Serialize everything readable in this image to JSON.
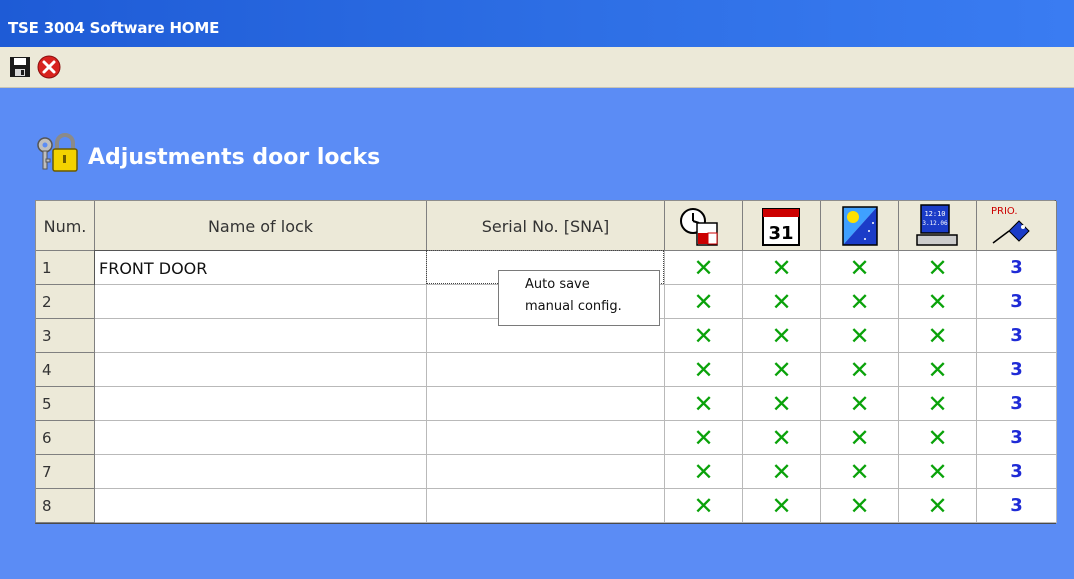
{
  "window": {
    "title": "TSE 3004 Software HOME"
  },
  "toolbar": {
    "save": {
      "icon": "floppy-disk-icon"
    },
    "close": {
      "icon": "red-x-close-icon"
    }
  },
  "page": {
    "title": "Adjustments door locks",
    "icon": "padlock-keys-icon"
  },
  "table": {
    "headers": {
      "num": "Num.",
      "name": "Name of lock",
      "serial": "Serial No. [SNA]",
      "icons": [
        "clock-onoff-icon",
        "calendar-icon",
        "sun-night-icon",
        "computer-clock-icon",
        "prio-key-icon"
      ],
      "prio_label": "PRIO."
    },
    "rows": [
      {
        "num": "1",
        "name": "FRONT DOOR",
        "serial": "",
        "flags": [
          "✕",
          "✕",
          "✕",
          "✕"
        ],
        "prio": "3"
      },
      {
        "num": "2",
        "name": "",
        "serial": "",
        "flags": [
          "✕",
          "✕",
          "✕",
          "✕"
        ],
        "prio": "3"
      },
      {
        "num": "3",
        "name": "",
        "serial": "",
        "flags": [
          "✕",
          "✕",
          "✕",
          "✕"
        ],
        "prio": "3"
      },
      {
        "num": "4",
        "name": "",
        "serial": "",
        "flags": [
          "✕",
          "✕",
          "✕",
          "✕"
        ],
        "prio": "3"
      },
      {
        "num": "5",
        "name": "",
        "serial": "",
        "flags": [
          "✕",
          "✕",
          "✕",
          "✕"
        ],
        "prio": "3"
      },
      {
        "num": "6",
        "name": "",
        "serial": "",
        "flags": [
          "✕",
          "✕",
          "✕",
          "✕"
        ],
        "prio": "3"
      },
      {
        "num": "7",
        "name": "",
        "serial": "",
        "flags": [
          "✕",
          "✕",
          "✕",
          "✕"
        ],
        "prio": "3"
      },
      {
        "num": "8",
        "name": "",
        "serial": "",
        "flags": [
          "✕",
          "✕",
          "✕",
          "✕"
        ],
        "prio": "3"
      }
    ]
  },
  "tooltip": {
    "line1": "Auto save",
    "line2": "manual config."
  },
  "colors": {
    "background": "#5b8cf5",
    "titlebar": "#2e6fe5",
    "check": "#0aa20a",
    "prio": "#1f2bd6"
  }
}
